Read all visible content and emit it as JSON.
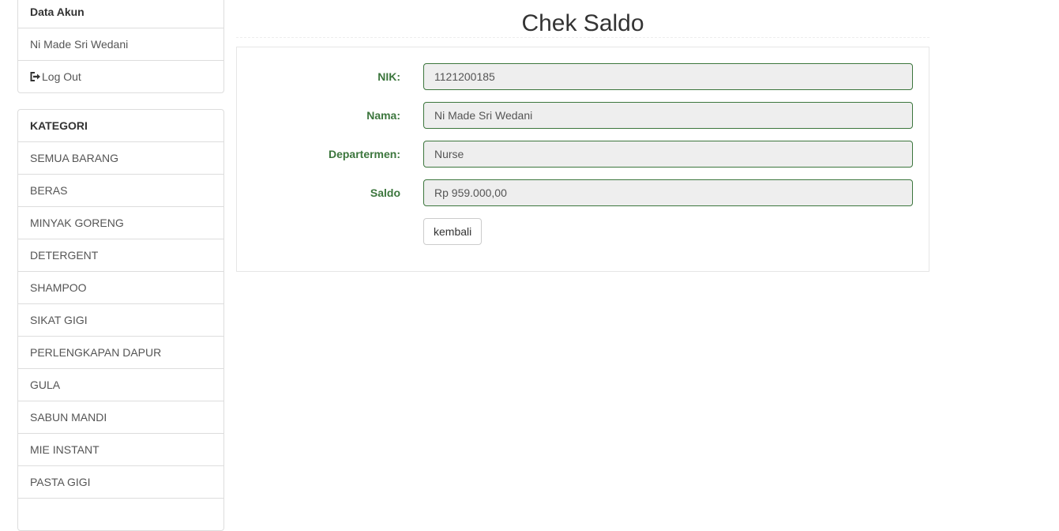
{
  "account": {
    "header": "Data Akun",
    "user_name": "Ni Made Sri Wedani",
    "logout_label": "Log Out",
    "logout_icon": "log-out-icon"
  },
  "categories": {
    "header": "KATEGORI",
    "items": [
      "SEMUA BARANG",
      "BERAS",
      "MINYAK GORENG",
      "DETERGENT",
      "SHAMPOO",
      "SIKAT GIGI",
      "PERLENGKAPAN DAPUR",
      "GULA",
      "SABUN MANDI",
      "MIE INSTANT",
      "PASTA GIGI"
    ]
  },
  "page": {
    "title": "Chek Saldo"
  },
  "form": {
    "fields": [
      {
        "label": "NIK:",
        "value": "1121200185"
      },
      {
        "label": "Nama:",
        "value": "Ni Made Sri Wedani"
      },
      {
        "label": "Departermen:",
        "value": "Nurse"
      },
      {
        "label": "Saldo",
        "value": "Rp 959.000,00"
      }
    ],
    "back_label": "kembali"
  },
  "colors": {
    "label_green": "#3c763d",
    "input_border_green": "#3c763d",
    "input_readonly_bg": "#eeeeee",
    "panel_border": "#dddddd"
  }
}
